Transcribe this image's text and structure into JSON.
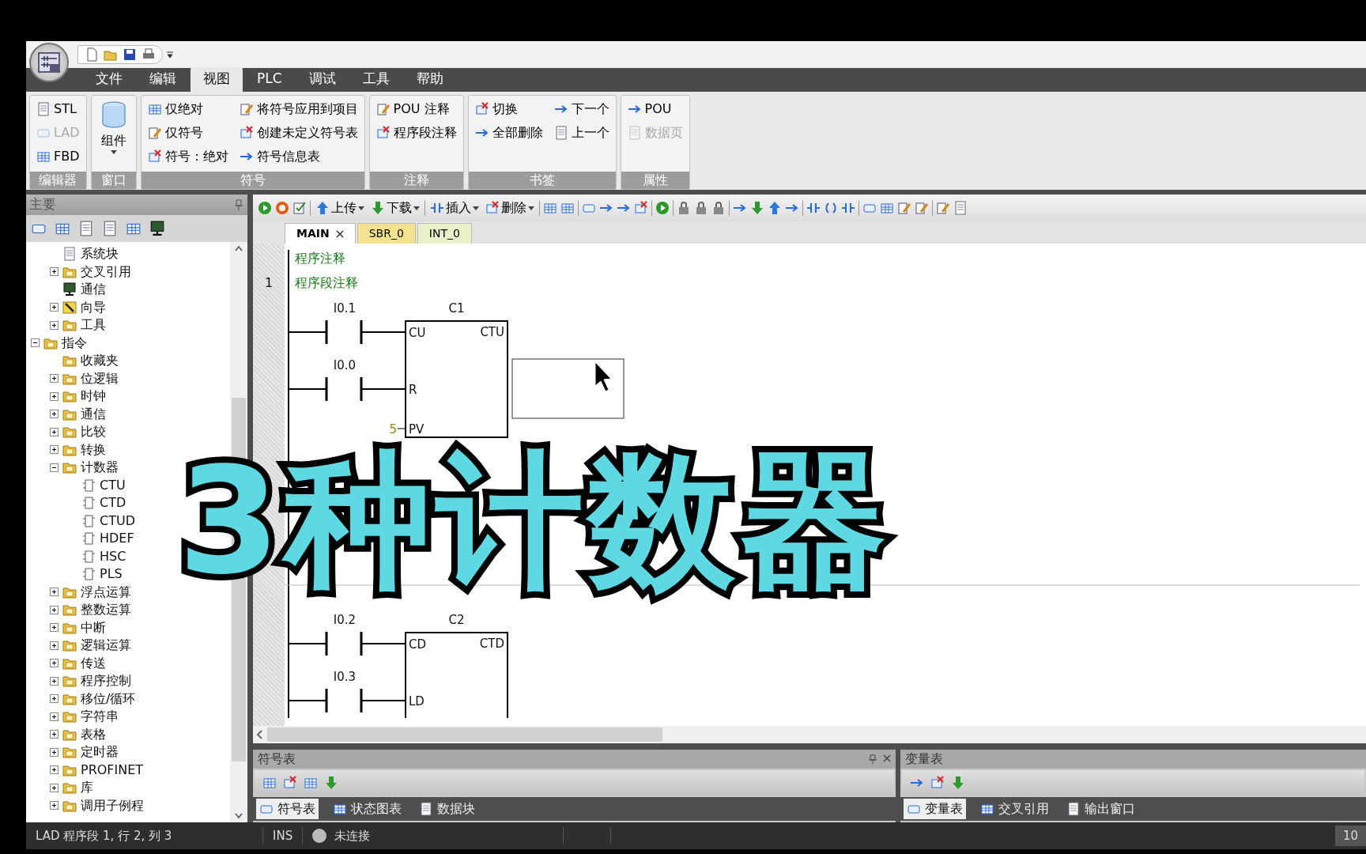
{
  "menu_tabs": [
    {
      "label": "文件",
      "selected": false
    },
    {
      "label": "编辑",
      "selected": false
    },
    {
      "label": "视图",
      "selected": true
    },
    {
      "label": "PLC",
      "selected": false
    },
    {
      "label": "调试",
      "selected": false
    },
    {
      "label": "工具",
      "selected": false
    },
    {
      "label": "帮助",
      "selected": false
    }
  ],
  "ribbon_groups": [
    {
      "title": "编辑器",
      "columns": [
        [
          {
            "label": "STL",
            "kind": "small",
            "disabled": false
          },
          {
            "label": "LAD",
            "kind": "small",
            "disabled": true
          },
          {
            "label": "FBD",
            "kind": "small",
            "disabled": false
          }
        ]
      ]
    },
    {
      "title": "窗口",
      "columns": [
        [
          {
            "label": "组件",
            "kind": "large",
            "disabled": false
          }
        ]
      ]
    },
    {
      "title": "符号",
      "columns": [
        [
          {
            "label": "仅绝对",
            "kind": "small",
            "disabled": false
          },
          {
            "label": "仅符号",
            "kind": "small",
            "disabled": false
          },
          {
            "label": "符号：绝对",
            "kind": "small",
            "disabled": false
          }
        ],
        [
          {
            "label": "将符号应用到项目",
            "kind": "small",
            "disabled": false
          },
          {
            "label": "创建未定义符号表",
            "kind": "small",
            "disabled": false
          },
          {
            "label": "符号信息表",
            "kind": "small",
            "disabled": false
          }
        ]
      ]
    },
    {
      "title": "注释",
      "columns": [
        [
          {
            "label": "POU 注释",
            "kind": "small",
            "disabled": false
          },
          {
            "label": "程序段注释",
            "kind": "small",
            "disabled": false
          }
        ]
      ]
    },
    {
      "title": "书签",
      "columns": [
        [
          {
            "label": "切换",
            "kind": "small",
            "disabled": false
          },
          {
            "label": "全部删除",
            "kind": "small",
            "disabled": false
          }
        ],
        [
          {
            "label": "下一个",
            "kind": "small",
            "disabled": false
          },
          {
            "label": "上一个",
            "kind": "small",
            "disabled": false
          }
        ]
      ]
    },
    {
      "title": "属性",
      "columns": [
        [
          {
            "label": "POU",
            "kind": "small",
            "disabled": false
          },
          {
            "label": "数据页",
            "kind": "small",
            "disabled": true
          }
        ]
      ]
    }
  ],
  "sidebar": {
    "title": "主要",
    "project_children": [
      {
        "label": "系统块",
        "kind": "document"
      },
      {
        "label": "交叉引用",
        "kind": "folder",
        "expanded": false
      },
      {
        "label": "通信",
        "kind": "monitor"
      },
      {
        "label": "向导",
        "kind": "wand",
        "expanded": false
      },
      {
        "label": "工具",
        "kind": "folder",
        "expanded": false
      }
    ],
    "tree": [
      {
        "label": "指令",
        "kind": "folder",
        "expanded": true,
        "children": [
          {
            "label": "收藏夹",
            "kind": "folder"
          },
          {
            "label": "位逻辑",
            "kind": "folder",
            "expanded": false
          },
          {
            "label": "时钟",
            "kind": "folder",
            "expanded": false
          },
          {
            "label": "通信",
            "kind": "folder",
            "expanded": false
          },
          {
            "label": "比较",
            "kind": "folder",
            "expanded": false
          },
          {
            "label": "转换",
            "kind": "folder",
            "expanded": false
          },
          {
            "label": "计数器",
            "kind": "folder",
            "expanded": true,
            "children": [
              {
                "label": "CTU",
                "kind": "block"
              },
              {
                "label": "CTD",
                "kind": "block"
              },
              {
                "label": "CTUD",
                "kind": "block"
              },
              {
                "label": "HDEF",
                "kind": "block"
              },
              {
                "label": "HSC",
                "kind": "block"
              },
              {
                "label": "PLS",
                "kind": "block"
              }
            ]
          },
          {
            "label": "浮点运算",
            "kind": "folder",
            "expanded": false
          },
          {
            "label": "整数运算",
            "kind": "folder",
            "expanded": false
          },
          {
            "label": "中断",
            "kind": "folder",
            "expanded": false
          },
          {
            "label": "逻辑运算",
            "kind": "folder",
            "expanded": false
          },
          {
            "label": "传送",
            "kind": "folder",
            "expanded": false
          },
          {
            "label": "程序控制",
            "kind": "folder",
            "expanded": false
          },
          {
            "label": "移位/循环",
            "kind": "folder",
            "expanded": false
          },
          {
            "label": "字符串",
            "kind": "folder",
            "expanded": false
          },
          {
            "label": "表格",
            "kind": "folder",
            "expanded": false
          },
          {
            "label": "定时器",
            "kind": "folder",
            "expanded": false
          },
          {
            "label": "PROFINET",
            "kind": "folder",
            "expanded": false
          },
          {
            "label": "库",
            "kind": "folder",
            "expanded": false
          },
          {
            "label": "调用子例程",
            "kind": "folder",
            "expanded": false
          }
        ]
      }
    ]
  },
  "program_toolbar": {
    "buttons": [
      "上传",
      "下载",
      "插入",
      "删除"
    ]
  },
  "editor_tabs": [
    {
      "label": "MAIN",
      "selected": true
    },
    {
      "label": "SBR_0",
      "selected": false
    },
    {
      "label": "INT_0",
      "selected": false
    }
  ],
  "program_comment": "程序注释",
  "networks": [
    {
      "number": "1",
      "comment": "程序段注释",
      "counter": {
        "name": "C1",
        "type": "CTU",
        "inputs": [
          {
            "pin": "CU",
            "contact": "I0.1"
          },
          {
            "pin": "R",
            "contact": "I0.0"
          },
          {
            "pin": "PV",
            "value": "5"
          }
        ]
      }
    },
    {
      "counter": {
        "name": "C2",
        "type": "CTD",
        "inputs": [
          {
            "pin": "CD",
            "contact": "I0.2"
          },
          {
            "pin": "LD",
            "contact": "I0.3"
          }
        ]
      }
    }
  ],
  "symbol_panel": {
    "title": "符号表",
    "tabs": [
      {
        "label": "符号表",
        "selected": true
      },
      {
        "label": "状态图表",
        "selected": false
      },
      {
        "label": "数据块",
        "selected": false
      }
    ]
  },
  "variable_panel": {
    "title": "变量表",
    "tabs": [
      {
        "label": "变量表",
        "selected": true
      },
      {
        "label": "交叉引用",
        "selected": false
      },
      {
        "label": "输出窗口",
        "selected": false
      }
    ]
  },
  "status_bar": {
    "position": "LAD 程序段 1, 行 2, 列 3",
    "mode": "INS",
    "connection": "未连接",
    "zoom": "10"
  },
  "overlay_caption": "3种计数器"
}
